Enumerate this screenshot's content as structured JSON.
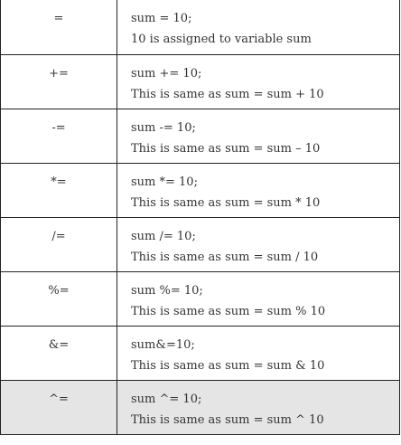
{
  "rows": [
    {
      "operator": "=",
      "example": "sum = 10;",
      "description": "10 is assigned to variable sum"
    },
    {
      "operator": "+=",
      "example": "sum += 10;",
      "description": "This is same as sum = sum + 10"
    },
    {
      "operator": "-=",
      "example": "sum -= 10;",
      "description": "This is same as sum = sum – 10"
    },
    {
      "operator": "*=",
      "example": "sum *= 10;",
      "description": "This is same as sum = sum * 10"
    },
    {
      "operator": "/=",
      "example": "sum /= 10;",
      "description": "This is same as sum = sum / 10"
    },
    {
      "operator": "%=",
      "example": "sum %= 10;",
      "description": "This is same as sum = sum % 10"
    },
    {
      "operator": "&=",
      "example": "sum&=10;",
      "description": "This is same as sum = sum & 10"
    },
    {
      "operator": "^=",
      "example": "sum ^= 10;",
      "description": "This is same as sum = sum ^ 10"
    }
  ],
  "colors": {
    "border": "#222222",
    "text": "#333333",
    "shaded_row": "#e5e5e5"
  }
}
